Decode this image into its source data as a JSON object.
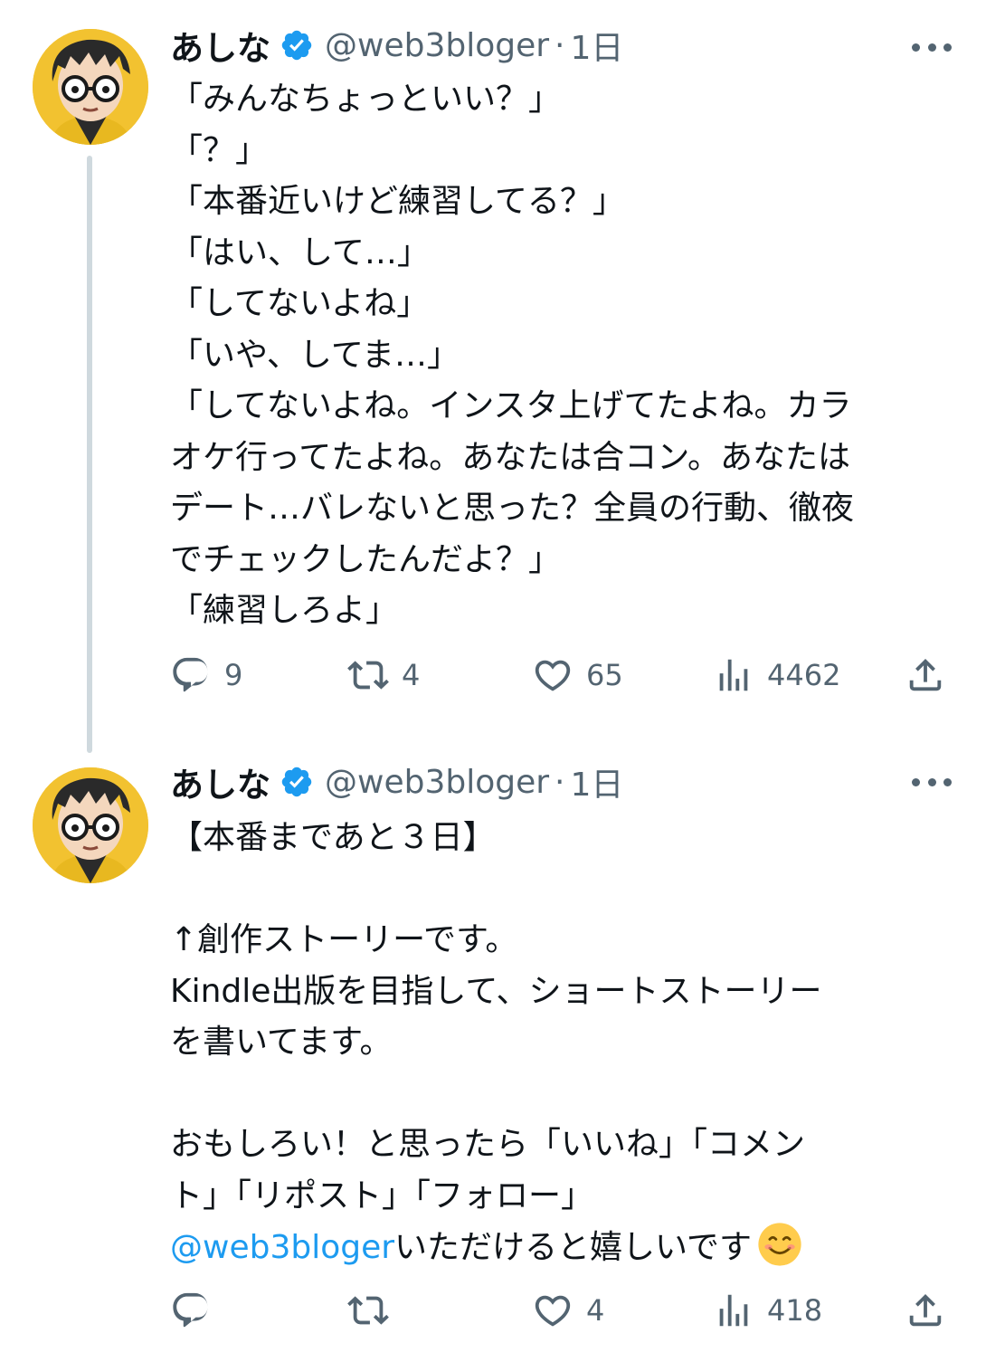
{
  "colors": {
    "text": "#0f1419",
    "secondary": "#536471",
    "accent": "#1d9bf0",
    "thread_line": "#cfd9de"
  },
  "tweets": [
    {
      "author": {
        "name": "あしな",
        "handle": "@web3bloger",
        "verified": true,
        "avatar": "avatar-illustration"
      },
      "separator": "·",
      "time": "1日",
      "lines": [
        "「みんなちょっといい？」",
        "「？」",
        "「本番近いけど練習してる？」",
        "「はい、して…」",
        "「してないよね」",
        "「いや、してま…」",
        "「してないよね。インスタ上げてたよね。カラ",
        "オケ行ってたよね。あなたは合コン。あなたは",
        "デート…バレないと思った？全員の行動、徹夜",
        "でチェックしたんだよ？」",
        "「練習しろよ」"
      ],
      "stats": {
        "replies": "9",
        "reposts": "4",
        "likes": "65",
        "views": "4462"
      }
    },
    {
      "author": {
        "name": "あしな",
        "handle": "@web3bloger",
        "verified": true,
        "avatar": "avatar-illustration"
      },
      "separator": "·",
      "time": "1日",
      "lines": [
        "【本番まであと３日】",
        "",
        "↑創作ストーリーです。",
        "Kindle出版を目指して、ショートストーリー",
        "を書いてます。",
        "",
        "おもしろい！と思ったら「いいね」「コメン",
        "ト」「リポスト」「フォロー」"
      ],
      "mention": "@web3bloger",
      "mention_suffix": "いただけると嬉しいです",
      "emoji": "smiling-face-emoji",
      "stats": {
        "replies": "",
        "reposts": "",
        "likes": "4",
        "views": "418"
      }
    }
  ],
  "icons": [
    "reply-icon",
    "repost-icon",
    "like-icon",
    "views-icon",
    "share-icon",
    "verified-badge-icon",
    "more-options-icon"
  ]
}
